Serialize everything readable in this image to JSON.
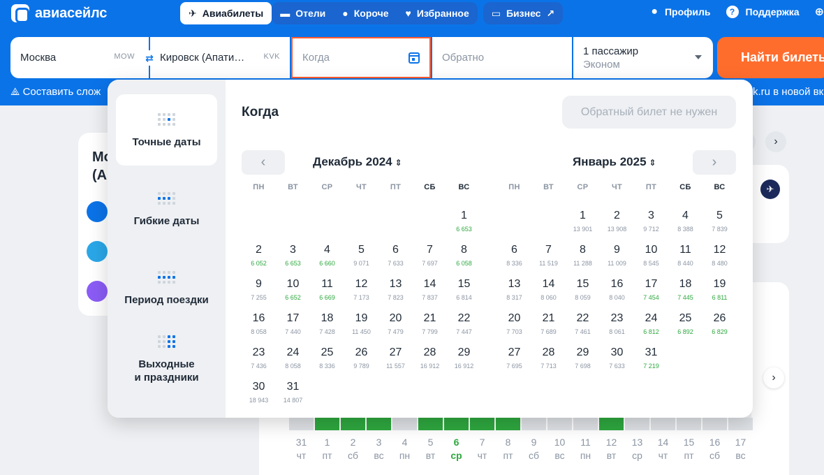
{
  "brand": "авиасейлс",
  "nav": {
    "tabs": [
      {
        "label": "Авиабилеты",
        "icon": "plane-icon",
        "active": true
      },
      {
        "label": "Отели",
        "icon": "bed-icon"
      },
      {
        "label": "Короче",
        "icon": "pin-icon"
      },
      {
        "label": "Избранное",
        "icon": "heart-icon"
      }
    ],
    "business": "Бизнес",
    "profile": "Профиль",
    "support": "Поддержка"
  },
  "search": {
    "from": "Москва",
    "from_code": "MOW",
    "to": "Кировск (Апати…",
    "to_code": "KVK",
    "when_placeholder": "Когда",
    "return_placeholder": "Обратно",
    "passengers": "1 пассажир",
    "class": "Эконом",
    "find_button": "Найти билеты"
  },
  "promo": {
    "left": "Составить слож",
    "right": "k.ru в новой вк"
  },
  "background": {
    "card_title_line1": "Мо",
    "card_title_line2": "(Ап",
    "bar_dates": [
      {
        "d": "31",
        "w": "чт"
      },
      {
        "d": "1",
        "w": "пт"
      },
      {
        "d": "2",
        "w": "сб"
      },
      {
        "d": "3",
        "w": "вс"
      },
      {
        "d": "4",
        "w": "пн"
      },
      {
        "d": "5",
        "w": "вт"
      },
      {
        "d": "6",
        "w": "ср"
      },
      {
        "d": "7",
        "w": "чт"
      },
      {
        "d": "8",
        "w": "пт"
      },
      {
        "d": "9",
        "w": "сб"
      },
      {
        "d": "10",
        "w": "вс"
      },
      {
        "d": "11",
        "w": "пн"
      },
      {
        "d": "12",
        "w": "вт"
      },
      {
        "d": "13",
        "w": "ср"
      },
      {
        "d": "14",
        "w": "чт"
      },
      {
        "d": "15",
        "w": "пт"
      },
      {
        "d": "16",
        "w": "сб"
      },
      {
        "d": "17",
        "w": "вс"
      }
    ],
    "highlight_date": "6"
  },
  "popup": {
    "title": "Когда",
    "no_return": "Обратный билет не нужен",
    "modes": [
      {
        "label": "Точные даты",
        "active": true
      },
      {
        "label": "Гибкие даты"
      },
      {
        "label": "Период поездки"
      },
      {
        "label": "Выходные\nи праздники"
      }
    ],
    "weekdays": [
      "ПН",
      "ВТ",
      "СР",
      "ЧТ",
      "ПТ",
      "СБ",
      "ВС"
    ],
    "months": [
      {
        "title": "Декабрь 2024",
        "offset": 6,
        "days": [
          {
            "n": "1",
            "p": "6 653",
            "g": true
          },
          {
            "n": "2",
            "p": "6 052",
            "g": true
          },
          {
            "n": "3",
            "p": "6 653",
            "g": true
          },
          {
            "n": "4",
            "p": "6 660",
            "g": true
          },
          {
            "n": "5",
            "p": "9 071"
          },
          {
            "n": "6",
            "p": "7 633"
          },
          {
            "n": "7",
            "p": "7 697"
          },
          {
            "n": "8",
            "p": "6 058",
            "g": true
          },
          {
            "n": "9",
            "p": "7 255"
          },
          {
            "n": "10",
            "p": "6 652",
            "g": true
          },
          {
            "n": "11",
            "p": "6 669",
            "g": true
          },
          {
            "n": "12",
            "p": "7 173"
          },
          {
            "n": "13",
            "p": "7 823"
          },
          {
            "n": "14",
            "p": "7 837"
          },
          {
            "n": "15",
            "p": "6 814"
          },
          {
            "n": "16",
            "p": "8 058"
          },
          {
            "n": "17",
            "p": "7 440"
          },
          {
            "n": "18",
            "p": "7 428"
          },
          {
            "n": "19",
            "p": "11 450"
          },
          {
            "n": "20",
            "p": "7 479"
          },
          {
            "n": "21",
            "p": "7 799"
          },
          {
            "n": "22",
            "p": "7 447"
          },
          {
            "n": "23",
            "p": "7 436"
          },
          {
            "n": "24",
            "p": "8 058"
          },
          {
            "n": "25",
            "p": "8 336"
          },
          {
            "n": "26",
            "p": "9 789"
          },
          {
            "n": "27",
            "p": "11 557"
          },
          {
            "n": "28",
            "p": "16 912"
          },
          {
            "n": "29",
            "p": "16 912"
          },
          {
            "n": "30",
            "p": "18 943"
          },
          {
            "n": "31",
            "p": "14 807"
          }
        ]
      },
      {
        "title": "Январь 2025",
        "offset": 2,
        "days": [
          {
            "n": "1",
            "p": "13 901"
          },
          {
            "n": "2",
            "p": "13 908"
          },
          {
            "n": "3",
            "p": "9 712"
          },
          {
            "n": "4",
            "p": "8 388"
          },
          {
            "n": "5",
            "p": "7 839"
          },
          {
            "n": "6",
            "p": "8 336"
          },
          {
            "n": "7",
            "p": "11 519"
          },
          {
            "n": "8",
            "p": "11 288"
          },
          {
            "n": "9",
            "p": "11 009"
          },
          {
            "n": "10",
            "p": "8 545"
          },
          {
            "n": "11",
            "p": "8 440"
          },
          {
            "n": "12",
            "p": "8 480"
          },
          {
            "n": "13",
            "p": "8 317"
          },
          {
            "n": "14",
            "p": "8 060"
          },
          {
            "n": "15",
            "p": "8 059"
          },
          {
            "n": "16",
            "p": "8 040"
          },
          {
            "n": "17",
            "p": "7 454",
            "g": true
          },
          {
            "n": "18",
            "p": "7 445",
            "g": true
          },
          {
            "n": "19",
            "p": "6 811",
            "g": true
          },
          {
            "n": "20",
            "p": "7 703"
          },
          {
            "n": "21",
            "p": "7 689"
          },
          {
            "n": "22",
            "p": "7 461"
          },
          {
            "n": "23",
            "p": "8 061"
          },
          {
            "n": "24",
            "p": "6 812",
            "g": true
          },
          {
            "n": "25",
            "p": "6 892",
            "g": true
          },
          {
            "n": "26",
            "p": "6 829",
            "g": true
          },
          {
            "n": "27",
            "p": "7 695"
          },
          {
            "n": "28",
            "p": "7 713"
          },
          {
            "n": "29",
            "p": "7 698"
          },
          {
            "n": "30",
            "p": "7 633"
          },
          {
            "n": "31",
            "p": "7 219",
            "g": true
          }
        ]
      }
    ]
  }
}
